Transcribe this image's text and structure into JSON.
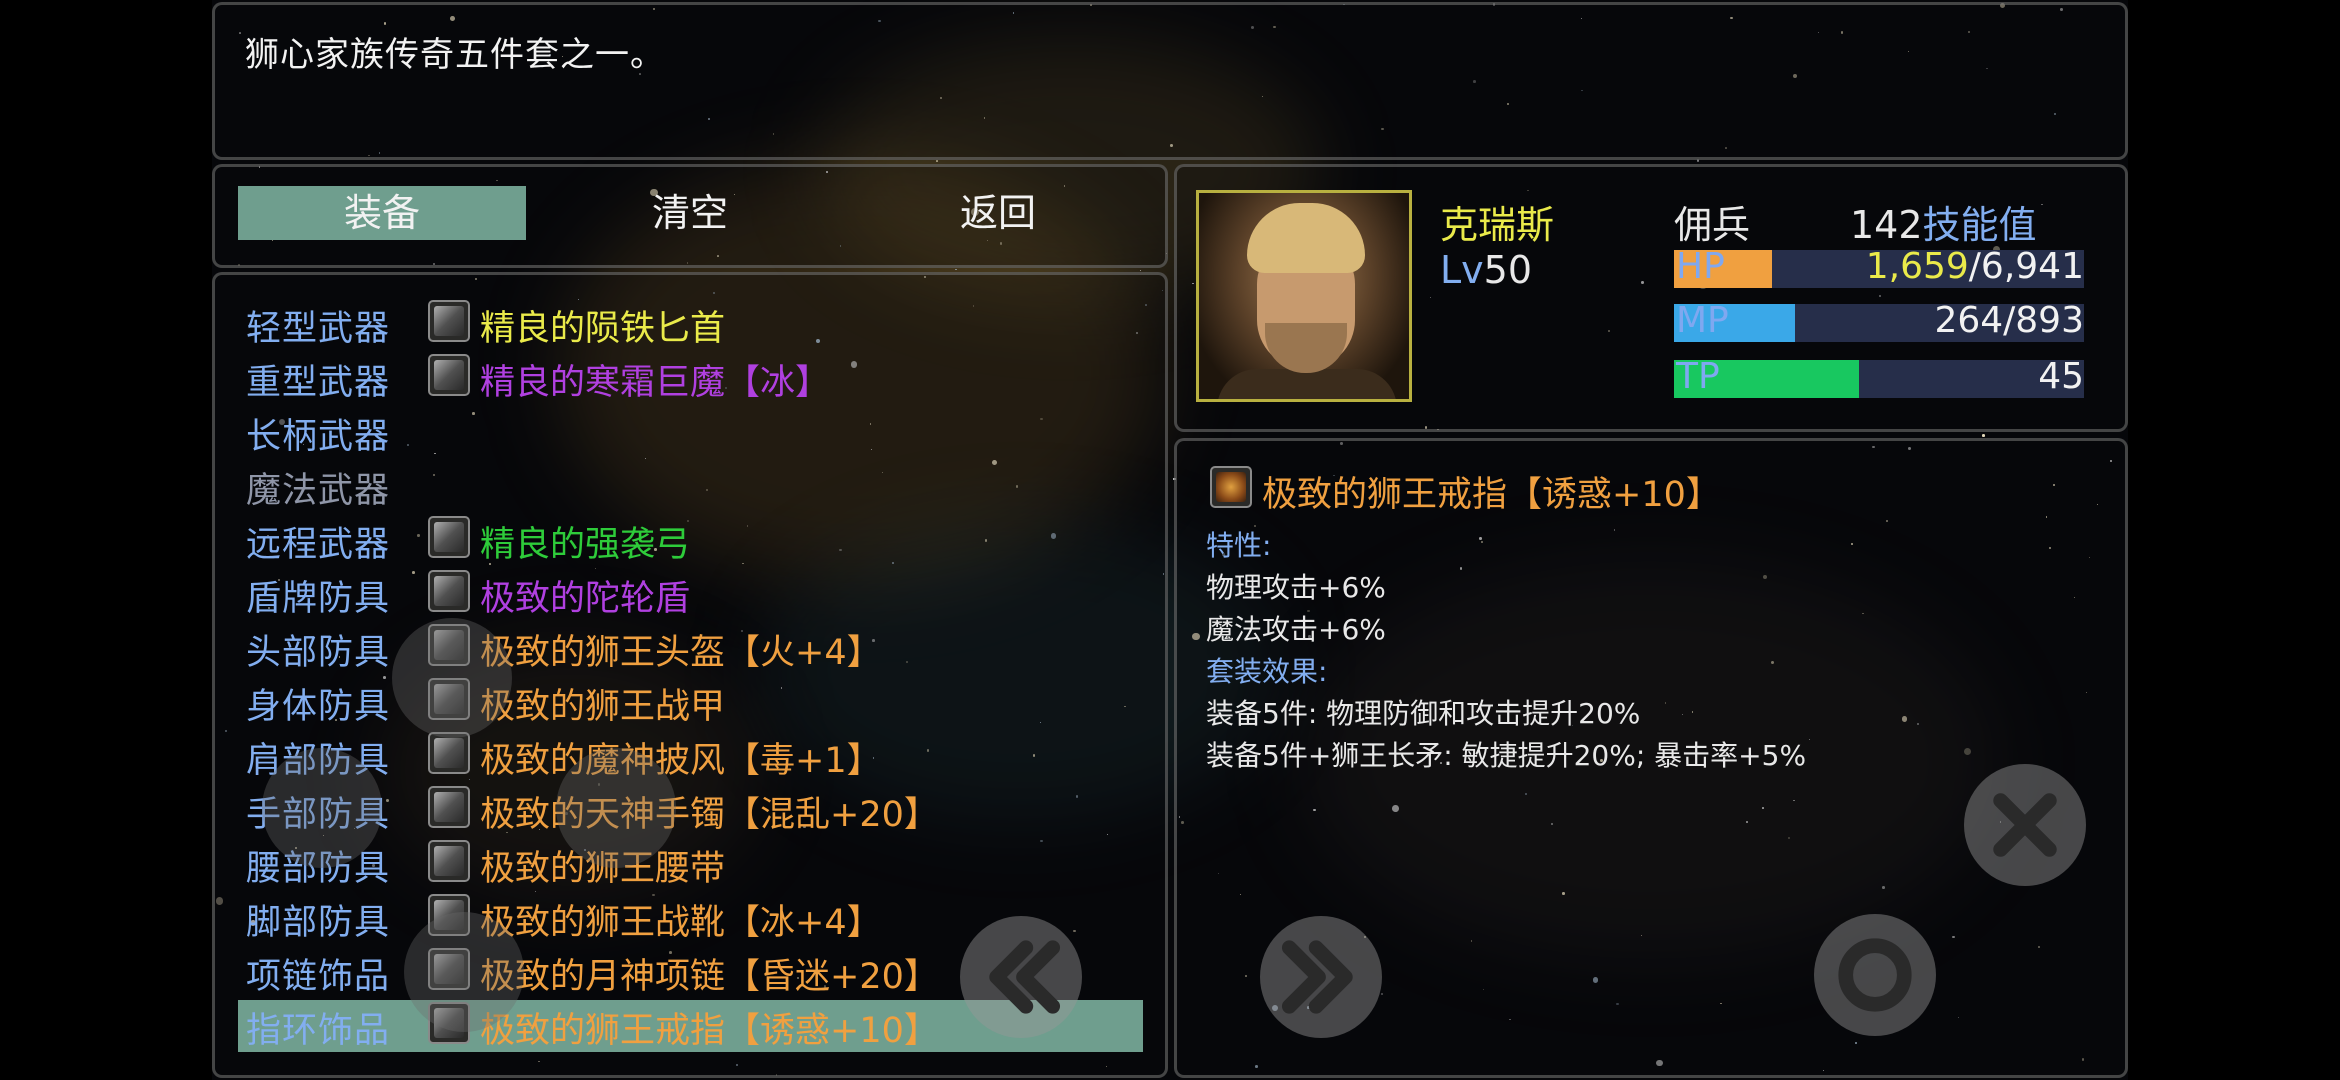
{
  "description": "狮心家族传奇五件套之一。",
  "tabs": [
    {
      "label": "装备",
      "active": true
    },
    {
      "label": "清空",
      "active": false
    },
    {
      "label": "返回",
      "active": false
    }
  ],
  "slots": [
    {
      "label": "轻型武器",
      "item": "精良的陨铁匕首",
      "color": "#eaea4a",
      "icon": "dagger-icon"
    },
    {
      "label": "重型武器",
      "item": "精良的寒霜巨魔【冰】",
      "color": "#b040e0",
      "icon": "greatsword-icon"
    },
    {
      "label": "长柄武器",
      "item": "",
      "color": "",
      "icon": ""
    },
    {
      "label": "魔法武器",
      "item": "",
      "color": "",
      "icon": "",
      "disabled": true
    },
    {
      "label": "远程武器",
      "item": "精良的强袭弓",
      "color": "#2ecc3a",
      "icon": "bow-icon"
    },
    {
      "label": "盾牌防具",
      "item": "极致的陀轮盾",
      "color": "#b040e0",
      "icon": "shield-icon"
    },
    {
      "label": "头部防具",
      "item": "极致的狮王头盔【火+4】",
      "color": "#f0a040",
      "icon": "helmet-icon"
    },
    {
      "label": "身体防具",
      "item": "极致的狮王战甲",
      "color": "#f0a040",
      "icon": "armor-icon"
    },
    {
      "label": "肩部防具",
      "item": "极致的魔神披风【毒+1】",
      "color": "#f0a040",
      "icon": "cloak-icon"
    },
    {
      "label": "手部防具",
      "item": "极致的天神手镯【混乱+20】",
      "color": "#f0a040",
      "icon": "bracelet-icon"
    },
    {
      "label": "腰部防具",
      "item": "极致的狮王腰带",
      "color": "#f0a040",
      "icon": "belt-icon"
    },
    {
      "label": "脚部防具",
      "item": "极致的狮王战靴【冰+4】",
      "color": "#f0a040",
      "icon": "boots-icon"
    },
    {
      "label": "项链饰品",
      "item": "极致的月神项链【昏迷+20】",
      "color": "#f0a040",
      "icon": "necklace-icon"
    },
    {
      "label": "指环饰品",
      "item": "极致的狮王戒指【诱惑+10】",
      "color": "#f0a040",
      "icon": "ring-icon",
      "selected": true
    }
  ],
  "character": {
    "name": "克瑞斯",
    "level_prefix": "Lv",
    "level": "50",
    "class": "佣兵",
    "skill_points": "142",
    "skill_label": "技能值",
    "hp": {
      "label": "HP",
      "current": "1,659",
      "max": "/6,941",
      "fraction": 0.239,
      "color": "#f0a040"
    },
    "mp": {
      "label": "MP",
      "value": "264/893",
      "fraction": 0.296,
      "color": "#3aa8e8"
    },
    "tp": {
      "label": "TP",
      "value": "45",
      "fraction": 0.45,
      "color": "#18c860"
    }
  },
  "detail": {
    "title": "极致的狮王戒指【诱惑+10】",
    "traits_head": "特性:",
    "traits": [
      "物理攻击+6%",
      "魔法攻击+6%"
    ],
    "set_head": "套装效果:",
    "set_effects": [
      "装备5件: 物理防御和攻击提升20%",
      "装备5件+狮王长矛: 敏捷提升20%; 暴击率+5%"
    ]
  },
  "colors": {
    "tab_active": "#6f9e8e",
    "slot_label": "#82aef0",
    "rare_yellow": "#eaea4a",
    "epic_purple": "#b040e0",
    "uncommon_green": "#2ecc3a",
    "legendary_orange": "#f0a040"
  },
  "controls": [
    "rewind-icon",
    "fast-forward-icon",
    "close-icon",
    "circle-icon"
  ]
}
